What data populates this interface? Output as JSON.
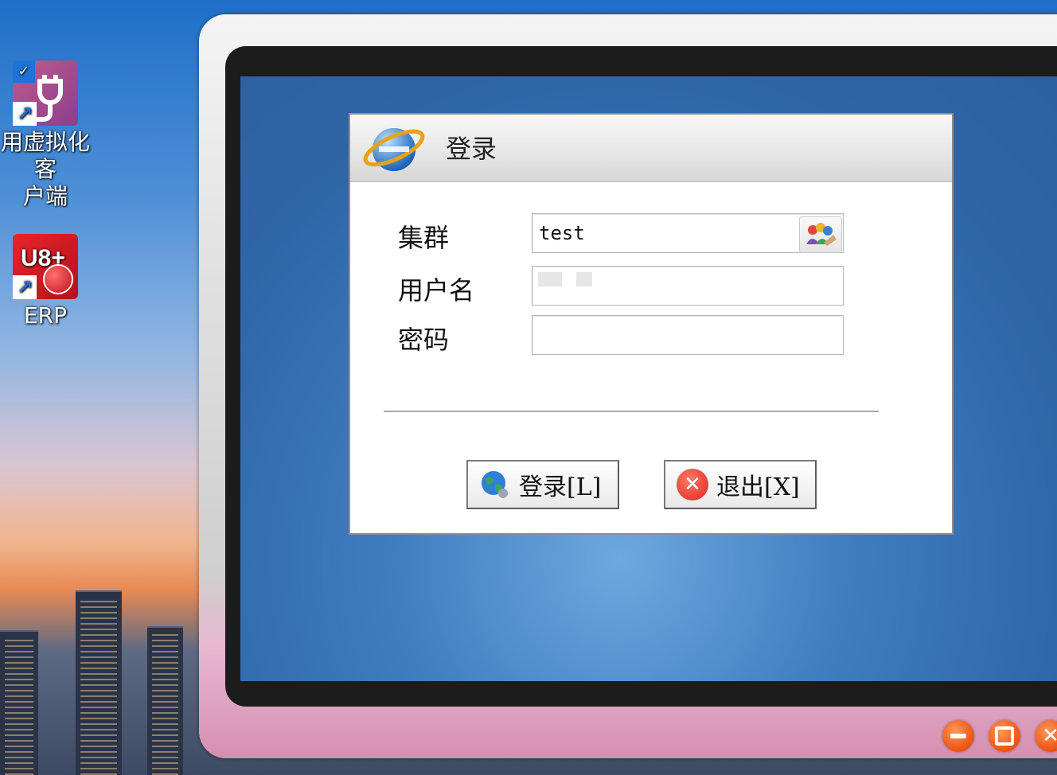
{
  "desktop": {
    "icons": [
      {
        "label_line1": "用虚拟化客",
        "label_line2": "户端",
        "icon": "plug-icon"
      },
      {
        "label_line1": "ERP",
        "label_line2": "",
        "icon": "u8-erp-icon"
      }
    ]
  },
  "dialog": {
    "title": "登录",
    "cluster_label": "集群",
    "cluster_value": "test",
    "username_label": "用户名",
    "username_value": "",
    "password_label": "密码",
    "password_value": "",
    "login_button": "登录[L]",
    "exit_button": "退出[X]"
  },
  "colors": {
    "accent_orange": "#f05a1a",
    "dialog_bg": "#ffffff",
    "screen_blue": "#3f7cc0"
  }
}
